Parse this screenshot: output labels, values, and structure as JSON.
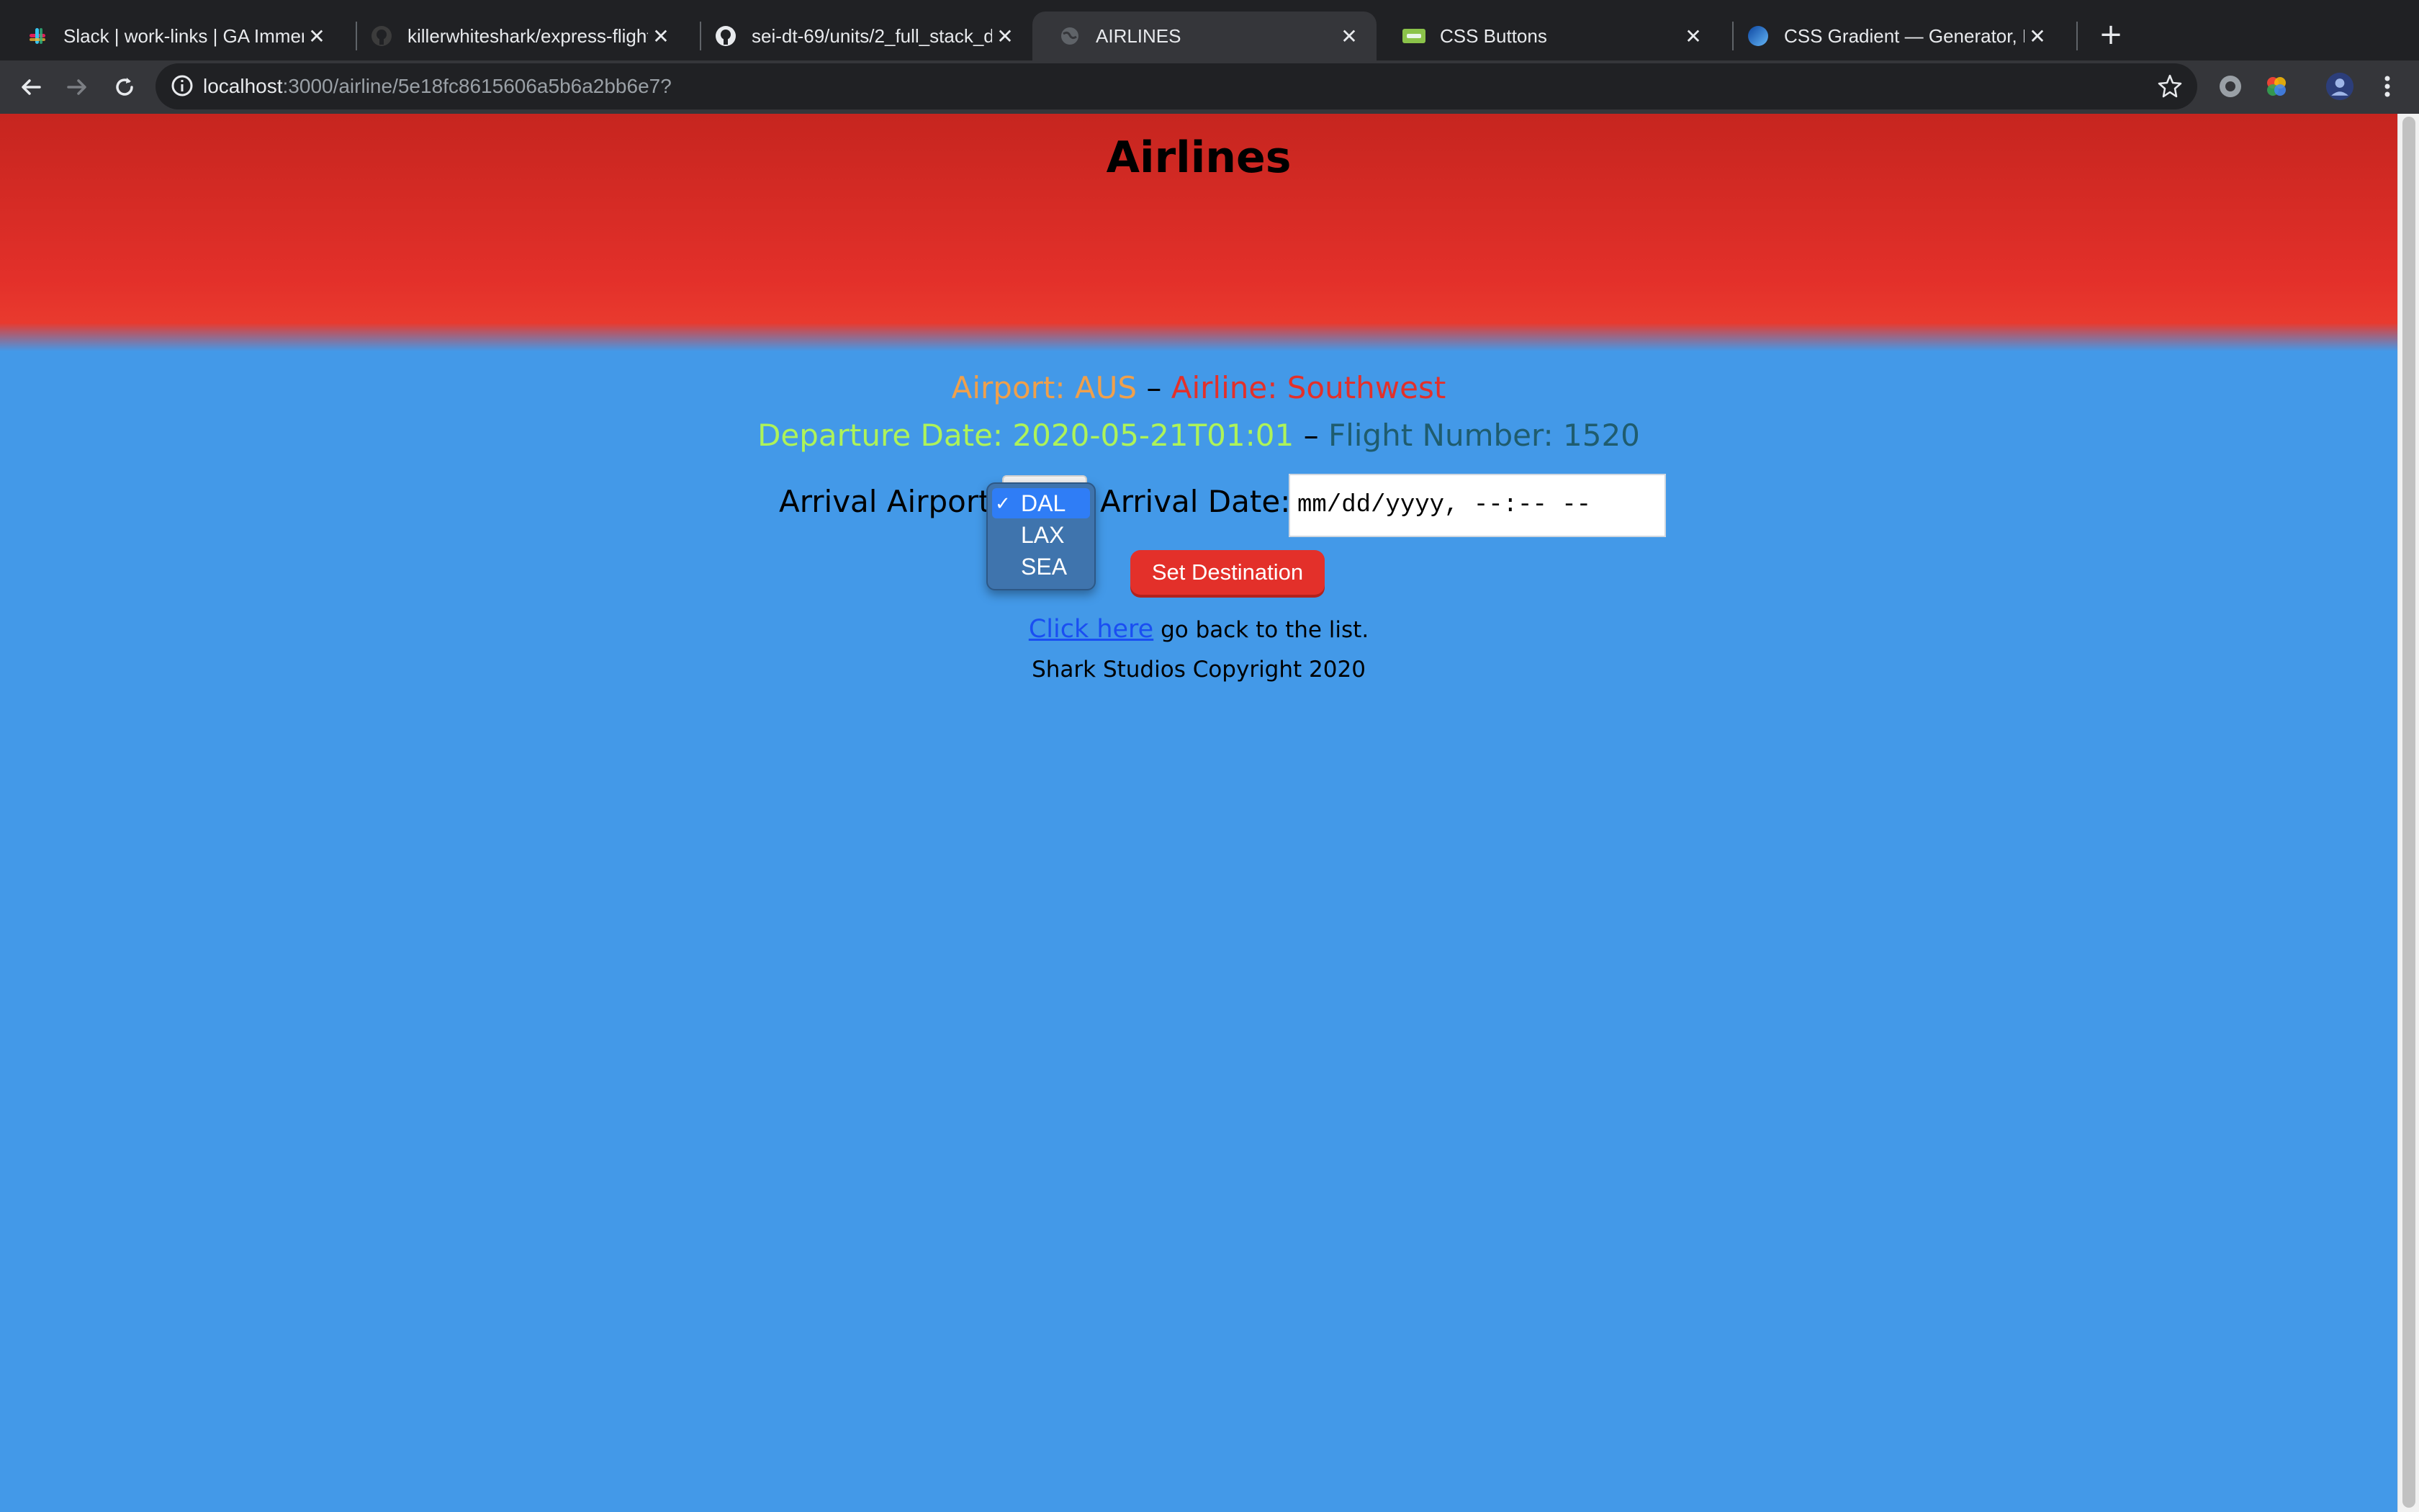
{
  "browser": {
    "tabs": [
      {
        "title": "Slack | work-links | GA Immersi",
        "icon": "slack-icon"
      },
      {
        "title": "killerwhiteshark/express-flight",
        "icon": "github-icon"
      },
      {
        "title": "sei-dt-69/units/2_full_stack_de",
        "icon": "github-icon"
      },
      {
        "title": "AIRLINES",
        "icon": "globe-icon"
      },
      {
        "title": "CSS Buttons",
        "icon": "css-buttons-icon"
      },
      {
        "title": "CSS Gradient — Generator, Ma",
        "icon": "css-gradient-icon"
      }
    ],
    "active_tab": 3,
    "url_host": "localhost",
    "url_path": ":3000/airline/5e18fc8615606a5b6a2bb6e7?"
  },
  "page": {
    "title": "Airlines",
    "airport_text": "Airport: AUS",
    "separator": "–",
    "airline_text": "Airline: Southwest",
    "departure_text": "Departure Date: 2020-05-21T01:01",
    "flight_text": "Flight Number: 1520",
    "arrival_airport_label": "Arrival Airport:",
    "arrival_airport_options": [
      "DAL",
      "LAX",
      "SEA"
    ],
    "arrival_airport_selected": "DAL",
    "check_mark": "✓",
    "arrival_date_label": "Arrival Date:",
    "arrival_date_placeholder": "mm/dd/yyyy, --:-- --",
    "set_destination_label": "Set Destination",
    "back_link_text": "Click here",
    "back_link_rest": " go back to the list.",
    "copyright": "Shark Studios Copyright 2020"
  },
  "colors": {
    "header_red": "#e3302a",
    "page_blue": "#4399e8",
    "airport_orange": "#f0a04b",
    "departure_green": "#aef359",
    "flight_teal": "#1f5c6e"
  }
}
